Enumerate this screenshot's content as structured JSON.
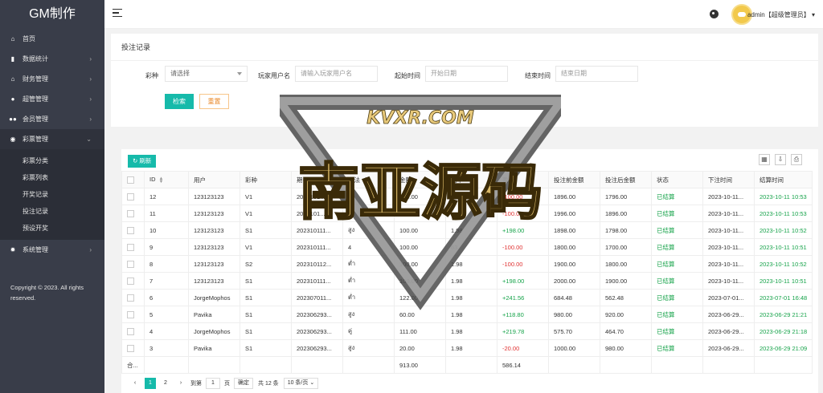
{
  "brand": "GM制作",
  "sidebar": {
    "items": [
      {
        "label": "首页",
        "icon": "home-icon",
        "arrow": ""
      },
      {
        "label": "数据统计",
        "icon": "chart-icon",
        "arrow": "›"
      },
      {
        "label": "财务管理",
        "icon": "bank-icon",
        "arrow": "›"
      },
      {
        "label": "超管管理",
        "icon": "user-icon",
        "arrow": "›"
      },
      {
        "label": "会员管理",
        "icon": "users-icon",
        "arrow": "›"
      },
      {
        "label": "彩票管理",
        "icon": "gamepad-icon",
        "arrow": "⌄"
      }
    ],
    "sub_items": [
      "彩票分类",
      "彩票列表",
      "开奖记录",
      "投注记录",
      "预设开奖"
    ],
    "extra_item": {
      "label": "系统管理",
      "icon": "gear-icon",
      "arrow": "›"
    },
    "copyright": "Copyright © 2023. All rights reserved."
  },
  "header": {
    "user": "admin【超级管理员】",
    "dropdown_caret": "▾"
  },
  "search": {
    "title": "投注记录",
    "lottery_label": "彩种",
    "lottery_value": "请选择",
    "user_label": "玩家用户名",
    "user_placeholder": "请输入玩家用户名",
    "start_label": "起始时间",
    "start_placeholder": "开始日期",
    "end_label": "结束时间",
    "end_placeholder": "结束日期",
    "search_btn": "检索",
    "reset_btn": "重置"
  },
  "table": {
    "refresh_label": "刷新",
    "headers": [
      "ID",
      "用户",
      "彩种",
      "期号",
      "玩法",
      "金额",
      "赔率",
      "盈亏",
      "投注前金额",
      "投注后金额",
      "状态",
      "下注时间",
      "结算时间"
    ],
    "rows": [
      [
        "12",
        "123123123",
        "V1",
        "2023101...",
        "5",
        "100.00",
        "",
        "-100.00",
        "1896.00",
        "1796.00",
        "已结算",
        "2023-10-11...",
        "2023-10-11 10:53"
      ],
      [
        "11",
        "123123123",
        "V1",
        "2023101...",
        "1",
        "100.00",
        "",
        "-100.00",
        "1996.00",
        "1896.00",
        "已结算",
        "2023-10-11...",
        "2023-10-11 10:53"
      ],
      [
        "10",
        "123123123",
        "S1",
        "202310111...",
        "สูง",
        "100.00",
        "1.98",
        "+198.00",
        "1898.00",
        "1798.00",
        "已结算",
        "2023-10-11...",
        "2023-10-11 10:52"
      ],
      [
        "9",
        "123123123",
        "V1",
        "202310111...",
        "4",
        "100.00",
        "63",
        "-100.00",
        "1800.00",
        "1700.00",
        "已结算",
        "2023-10-11...",
        "2023-10-11 10:51"
      ],
      [
        "8",
        "123123123",
        "S2",
        "202310112...",
        "ต่ำ",
        "100.00",
        "1.98",
        "-100.00",
        "1900.00",
        "1800.00",
        "已结算",
        "2023-10-11...",
        "2023-10-11 10:52"
      ],
      [
        "7",
        "123123123",
        "S1",
        "202310111...",
        "ต่ำ",
        "100.00",
        "1.98",
        "+198.00",
        "2000.00",
        "1900.00",
        "已结算",
        "2023-10-11...",
        "2023-10-11 10:51"
      ],
      [
        "6",
        "JorgeMophos",
        "S1",
        "202307011...",
        "ต่ำ",
        "122.00",
        "1.98",
        "+241.56",
        "684.48",
        "562.48",
        "已结算",
        "2023-07-01...",
        "2023-07-01 16:48"
      ],
      [
        "5",
        "Pavika",
        "S1",
        "202306293...",
        "สูง",
        "60.00",
        "1.98",
        "+118.80",
        "980.00",
        "920.00",
        "已结算",
        "2023-06-29...",
        "2023-06-29 21:21"
      ],
      [
        "4",
        "JorgeMophos",
        "S1",
        "202306293...",
        "คู่",
        "111.00",
        "1.98",
        "+219.78",
        "575.70",
        "464.70",
        "已结算",
        "2023-06-29...",
        "2023-06-29 21:18"
      ],
      [
        "3",
        "Pavika",
        "S1",
        "202306293...",
        "สูง",
        "20.00",
        "1.98",
        "-20.00",
        "1000.00",
        "980.00",
        "已结算",
        "2023-06-29...",
        "2023-06-29 21:09"
      ]
    ],
    "total_label": "合...",
    "total_amount": "913.00",
    "total_profit": "586.14"
  },
  "pager": {
    "prev": "‹",
    "current": "1",
    "next_page": "2",
    "next": "›",
    "goto_label": "到第",
    "goto_value": "1",
    "page_unit": "页",
    "confirm": "确定",
    "total": "共 12 条",
    "size": "10 条/页"
  },
  "watermark": {
    "site": "KVXR.COM",
    "text": "南亚源码"
  },
  "colors": {
    "sidebar": "#393d49",
    "accent": "#16baaa",
    "positive": "#16a34a",
    "negative": "#e03131"
  }
}
